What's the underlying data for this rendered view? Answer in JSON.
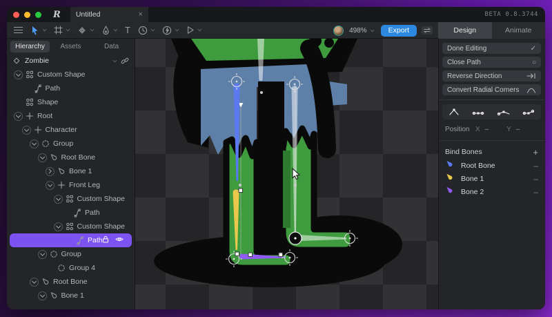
{
  "window": {
    "tab_title": "Untitled",
    "beta_label": "BETA 0.8.3744"
  },
  "icons": {
    "logo": "R",
    "close": "×",
    "check": "✓",
    "circle_empty": "○",
    "plus": "+",
    "minus": "–",
    "text_tool": "T"
  },
  "toolbar": {
    "zoom_level": "498%",
    "export_label": "Export",
    "mode_tabs": [
      {
        "label": "Design",
        "active": true
      },
      {
        "label": "Animate",
        "active": false
      }
    ]
  },
  "sidebar": {
    "tabs": [
      {
        "label": "Hierarchy",
        "active": true
      },
      {
        "label": "Assets",
        "active": false
      },
      {
        "label": "Data",
        "active": false
      }
    ],
    "artboard": {
      "name": "Zombie"
    },
    "tree": [
      {
        "indent": 0,
        "caret": "down",
        "icon": "shape",
        "label": "Custom Shape"
      },
      {
        "indent": 1,
        "caret": "",
        "icon": "path",
        "label": "Path"
      },
      {
        "indent": 0,
        "caret": "",
        "icon": "shape",
        "label": "Shape"
      },
      {
        "indent": 0,
        "caret": "down",
        "icon": "transform",
        "label": "Root"
      },
      {
        "indent": 1,
        "caret": "down",
        "icon": "transform",
        "label": "Character"
      },
      {
        "indent": 2,
        "caret": "down",
        "icon": "group",
        "label": "Group"
      },
      {
        "indent": 3,
        "caret": "down",
        "icon": "bone",
        "label": "Root Bone"
      },
      {
        "indent": 4,
        "caret": "right",
        "icon": "bone",
        "label": "Bone 1"
      },
      {
        "indent": 4,
        "caret": "down",
        "icon": "transform",
        "label": "Front Leg"
      },
      {
        "indent": 5,
        "caret": "down",
        "icon": "shape",
        "label": "Custom Shape"
      },
      {
        "indent": 6,
        "caret": "",
        "icon": "path",
        "label": "Path"
      },
      {
        "indent": 5,
        "caret": "down",
        "icon": "shape",
        "label": "Custom Shape"
      },
      {
        "indent": 6,
        "caret": "",
        "icon": "path",
        "label": "Path",
        "selected": true,
        "lock": true,
        "eye": true
      },
      {
        "indent": 3,
        "caret": "down",
        "icon": "group",
        "label": "Group"
      },
      {
        "indent": 4,
        "caret": "",
        "icon": "group",
        "label": "Group 4"
      },
      {
        "indent": 2,
        "caret": "down",
        "icon": "bone",
        "label": "Root Bone"
      },
      {
        "indent": 3,
        "caret": "down",
        "icon": "bone",
        "label": "Bone 1"
      }
    ]
  },
  "inspector": {
    "action_buttons": [
      {
        "label": "Done Editing",
        "icon": "check"
      },
      {
        "label": "Close Path",
        "icon": "circle"
      },
      {
        "label": "Reverse Direction",
        "icon": "reverse"
      },
      {
        "label": "Convert Radial Corners",
        "icon": "radial"
      }
    ],
    "position": {
      "label": "Position",
      "x_label": "X",
      "x_value": "–",
      "y_label": "Y",
      "y_value": "–"
    },
    "bind_bones": {
      "title": "Bind Bones",
      "bones": [
        {
          "name": "Root Bone",
          "color": "#5B79F0"
        },
        {
          "name": "Bone 1",
          "color": "#E9C84B"
        },
        {
          "name": "Bone 2",
          "color": "#8F5BF0"
        }
      ]
    }
  },
  "canvas": {
    "checker": {
      "light": "#323235",
      "dark": "#252528"
    },
    "character": {
      "green": "#3E9B3E",
      "dark_green": "#2E7A31",
      "blue": "#5E80A8",
      "outline": "#0A0A0A"
    },
    "bone_colors": {
      "blue": "#5B79F0",
      "yellow": "#E9C84B",
      "purple": "#8F5BF0",
      "white": "rgba(255,255,255,0.5)"
    }
  }
}
